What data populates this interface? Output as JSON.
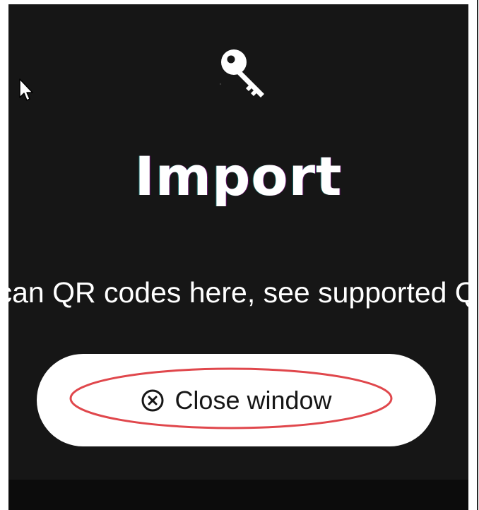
{
  "dialog": {
    "title": "Import",
    "subtitle": "You can scan QR codes here, see supported QR codes",
    "close_button_label": "Close window"
  },
  "icons": {
    "header": "key-icon",
    "close": "close-circle-icon",
    "cursor": "mouse-cursor-icon"
  },
  "colors": {
    "background": "#161616",
    "text": "#ffffff",
    "button_bg": "#ffffff",
    "button_text": "#161616",
    "highlight": "#e0474c"
  }
}
